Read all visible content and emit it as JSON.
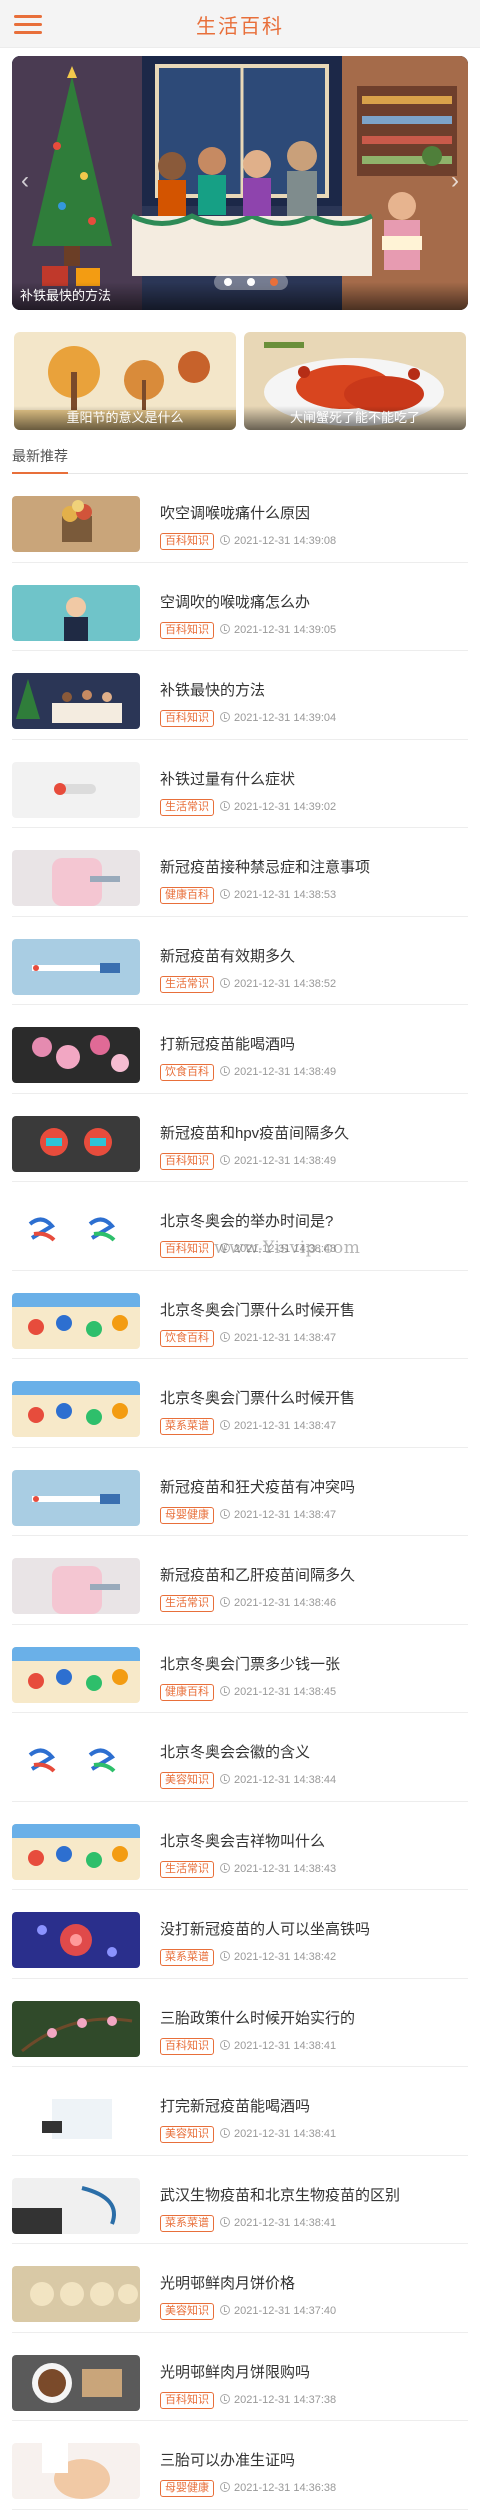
{
  "header": {
    "title": "生活百科",
    "menu_icon": "hamburger-menu-icon"
  },
  "banner": {
    "caption": "补铁最快的方法",
    "slide_count": 3,
    "active_slide": 3
  },
  "promos": [
    {
      "caption": "重阳节的意义是什么"
    },
    {
      "caption": "大闸蟹死了能不能吃了"
    }
  ],
  "section": {
    "title": "最新推荐"
  },
  "watermark": "www.Yisvip.com",
  "colors": {
    "accent": "#e86f3a"
  },
  "articles": [
    {
      "title": "吹空调喉咙痛什么原因",
      "tag": "百科知识",
      "time": "2021-12-31 14:39:08"
    },
    {
      "title": "空调吹的喉咙痛怎么办",
      "tag": "百科知识",
      "time": "2021-12-31 14:39:05"
    },
    {
      "title": "补铁最快的方法",
      "tag": "百科知识",
      "time": "2021-12-31 14:39:04"
    },
    {
      "title": "补铁过量有什么症状",
      "tag": "生活常识",
      "time": "2021-12-31 14:39:02"
    },
    {
      "title": "新冠疫苗接种禁忌症和注意事项",
      "tag": "健康百科",
      "time": "2021-12-31 14:38:53"
    },
    {
      "title": "新冠疫苗有效期多久",
      "tag": "生活常识",
      "time": "2021-12-31 14:38:52"
    },
    {
      "title": "打新冠疫苗能喝酒吗",
      "tag": "饮食百科",
      "time": "2021-12-31 14:38:49"
    },
    {
      "title": "新冠疫苗和hpv疫苗间隔多久",
      "tag": "百科知识",
      "time": "2021-12-31 14:38:49"
    },
    {
      "title": "北京冬奥会的举办时间是?",
      "tag": "百科知识",
      "time": "2021-12-31 14:38:48"
    },
    {
      "title": "北京冬奥会门票什么时候开售",
      "tag": "饮食百科",
      "time": "2021-12-31 14:38:47"
    },
    {
      "title": "北京冬奥会门票什么时候开售",
      "tag": "菜系菜谱",
      "time": "2021-12-31 14:38:47"
    },
    {
      "title": "新冠疫苗和狂犬疫苗有冲突吗",
      "tag": "母婴健康",
      "time": "2021-12-31 14:38:47"
    },
    {
      "title": "新冠疫苗和乙肝疫苗间隔多久",
      "tag": "生活常识",
      "time": "2021-12-31 14:38:46"
    },
    {
      "title": "北京冬奥会门票多少钱一张",
      "tag": "健康百科",
      "time": "2021-12-31 14:38:45"
    },
    {
      "title": "北京冬奥会会徽的含义",
      "tag": "美容知识",
      "time": "2021-12-31 14:38:44"
    },
    {
      "title": "北京冬奥会吉祥物叫什么",
      "tag": "生活常识",
      "time": "2021-12-31 14:38:43"
    },
    {
      "title": "没打新冠疫苗的人可以坐高铁吗",
      "tag": "菜系菜谱",
      "time": "2021-12-31 14:38:42"
    },
    {
      "title": "三胎政策什么时候开始实行的",
      "tag": "百科知识",
      "time": "2021-12-31 14:38:41"
    },
    {
      "title": "打完新冠疫苗能喝酒吗",
      "tag": "美容知识",
      "time": "2021-12-31 14:38:41"
    },
    {
      "title": "武汉生物疫苗和北京生物疫苗的区别",
      "tag": "菜系菜谱",
      "time": "2021-12-31 14:38:41"
    },
    {
      "title": "光明邨鲜肉月饼价格",
      "tag": "美容知识",
      "time": "2021-12-31 14:37:40"
    },
    {
      "title": "光明邨鲜肉月饼限购吗",
      "tag": "百科知识",
      "time": "2021-12-31 14:37:38"
    },
    {
      "title": "三胎可以办准生证吗",
      "tag": "母婴健康",
      "time": "2021-12-31 14:36:38"
    }
  ]
}
